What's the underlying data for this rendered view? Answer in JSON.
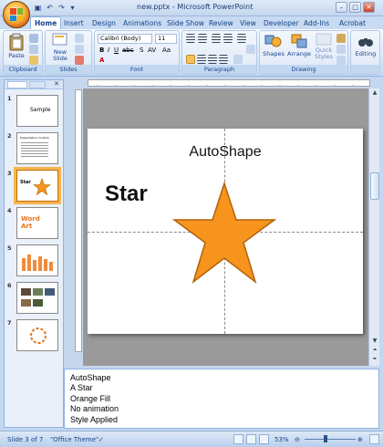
{
  "window": {
    "title": "new.pptx - Microsoft PowerPoint",
    "minimize_icon": "minimize-icon",
    "maximize_icon": "maximize-icon",
    "close_icon": "close-icon"
  },
  "quick_access": [
    "save-icon",
    "undo-icon",
    "redo-icon",
    "customize-icon"
  ],
  "ribbon": {
    "tabs": [
      "Home",
      "Insert",
      "Design",
      "Animations",
      "Slide Show",
      "Review",
      "View",
      "Developer",
      "Add-Ins",
      "Acrobat"
    ],
    "active_tab": "Home",
    "groups": {
      "clipboard": {
        "label": "Clipboard",
        "paste": "Paste"
      },
      "slides": {
        "label": "Slides",
        "new_slide": "New",
        "new_slide_2": "Slide"
      },
      "font": {
        "label": "Font",
        "font_name": "Calibri (Body)",
        "font_size": "11"
      },
      "paragraph": {
        "label": "Paragraph"
      },
      "drawing": {
        "label": "Drawing",
        "shapes": "Shapes",
        "arrange": "Arrange",
        "quick_styles_1": "Quick",
        "quick_styles_2": "Styles"
      },
      "editing": {
        "label": "",
        "editing": "Editing"
      }
    }
  },
  "slides_panel": {
    "thumbnails": [
      {
        "num": "1",
        "title": "Sample"
      },
      {
        "num": "2",
        "title": "Presentation Content"
      },
      {
        "num": "3",
        "title": "Star",
        "selected": true
      },
      {
        "num": "4",
        "title": "Word Art"
      },
      {
        "num": "5",
        "title": ""
      },
      {
        "num": "6",
        "title": ""
      },
      {
        "num": "7",
        "title": ""
      }
    ]
  },
  "slide": {
    "title": "AutoShape",
    "text": "Star",
    "shape_fill": "#f7941d",
    "shape_stroke": "#b0620a"
  },
  "notes": {
    "lines": [
      "AutoShape",
      "A Star",
      "Orange Fill",
      "No animation",
      "Style Applied"
    ]
  },
  "status": {
    "slide_info": "Slide 3 of 7",
    "theme": "\"Office Theme\"",
    "zoom": "53%"
  },
  "colors": {
    "accent_orange": "#f7941d",
    "ribbon_blue": "#15428b"
  }
}
